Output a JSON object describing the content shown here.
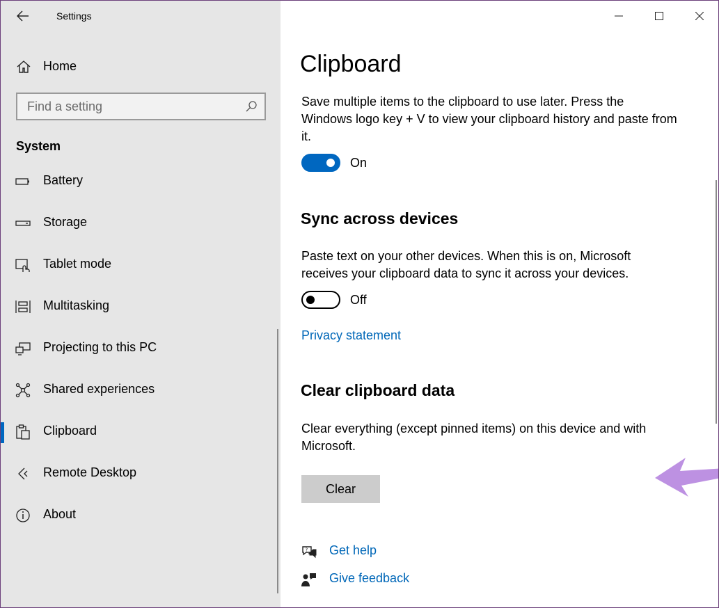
{
  "window": {
    "title": "Settings"
  },
  "sidebar": {
    "home_label": "Home",
    "search": {
      "placeholder": "Find a setting"
    },
    "section_header": "System",
    "items": [
      {
        "label": "Battery",
        "icon": "battery-icon"
      },
      {
        "label": "Storage",
        "icon": "storage-icon"
      },
      {
        "label": "Tablet mode",
        "icon": "tablet-mode-icon"
      },
      {
        "label": "Multitasking",
        "icon": "multitasking-icon"
      },
      {
        "label": "Projecting to this PC",
        "icon": "projecting-icon"
      },
      {
        "label": "Shared experiences",
        "icon": "shared-experiences-icon"
      },
      {
        "label": "Clipboard",
        "icon": "clipboard-icon",
        "active": true
      },
      {
        "label": "Remote Desktop",
        "icon": "remote-desktop-icon"
      },
      {
        "label": "About",
        "icon": "info-icon"
      }
    ]
  },
  "main": {
    "title": "Clipboard",
    "history": {
      "description": "Save multiple items to the clipboard to use later. Press the Windows logo key + V to view your clipboard history and paste from it.",
      "toggle_state": "On"
    },
    "sync": {
      "title": "Sync across devices",
      "description": "Paste text on your other devices. When this is on, Microsoft receives your clipboard data to sync it across your devices.",
      "toggle_state": "Off",
      "privacy_link": "Privacy statement"
    },
    "clear": {
      "title": "Clear clipboard data",
      "description": "Clear everything (except pinned items) on this device and with Microsoft.",
      "button_label": "Clear"
    },
    "help": {
      "get_help": "Get help",
      "give_feedback": "Give feedback"
    }
  },
  "colors": {
    "accent": "#0067c0",
    "link": "#0067b8",
    "sidebar_bg": "#e6e6e6",
    "annotation_arrow": "#b98be0"
  }
}
